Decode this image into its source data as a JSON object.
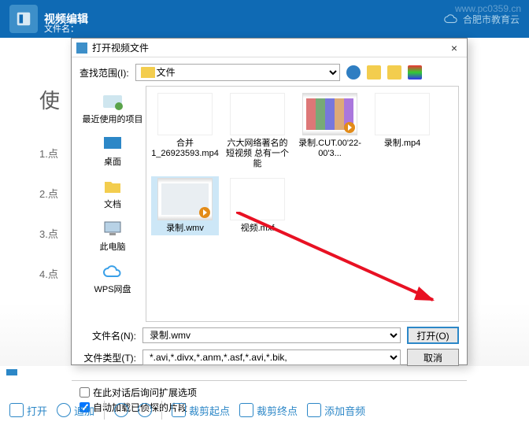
{
  "header": {
    "title": "视频编辑",
    "filename_label": "文件名：",
    "watermark": "www.pc0359.cn",
    "cloud_text": "合肥市教育云"
  },
  "content": {
    "title": "使",
    "steps": [
      "1.点",
      "2.点",
      "3.点",
      "4.点"
    ]
  },
  "dialog": {
    "title": "打开视频文件",
    "close": "×",
    "look_in_label": "查找范围(I):",
    "look_in_value": "文件",
    "sidebar": [
      {
        "label": "最近使用的项目",
        "color": "#cfe6ef"
      },
      {
        "label": "桌面",
        "color": "#2c87c7"
      },
      {
        "label": "文档",
        "color": "#f3cd4e"
      },
      {
        "label": "此电脑",
        "color": "#b8d2e6"
      },
      {
        "label": "WPS网盘",
        "color": "#3aa0e8"
      }
    ],
    "files": [
      {
        "name": "合并1_26923593.mp4",
        "type": "blank"
      },
      {
        "name": "六大网络著名的短视频 总有一个能",
        "type": "blank"
      },
      {
        "name": "录制.CUT.00'22-00'3...",
        "type": "video"
      },
      {
        "name": "录制.mp4",
        "type": "blank"
      },
      {
        "name": "录制.wmv",
        "type": "video",
        "selected": true
      },
      {
        "name": "视频.mxf",
        "type": "blank"
      }
    ],
    "filename_label": "文件名(N):",
    "filename_value": "录制.wmv",
    "filetype_label": "文件类型(T):",
    "filetype_value": "*.avi,*.divx,*.anm,*.asf,*.avi,*.bik,",
    "open_btn": "打开(O)",
    "cancel_btn": "取消",
    "check1": "在此对话后询问扩展选项",
    "check2": "自动加载已侦探的片段"
  },
  "bottom": {
    "b1": "打开",
    "b2": "追加",
    "b3": "",
    "b4": "裁剪起点",
    "b5": "裁剪终点",
    "b6": "添加音频"
  }
}
